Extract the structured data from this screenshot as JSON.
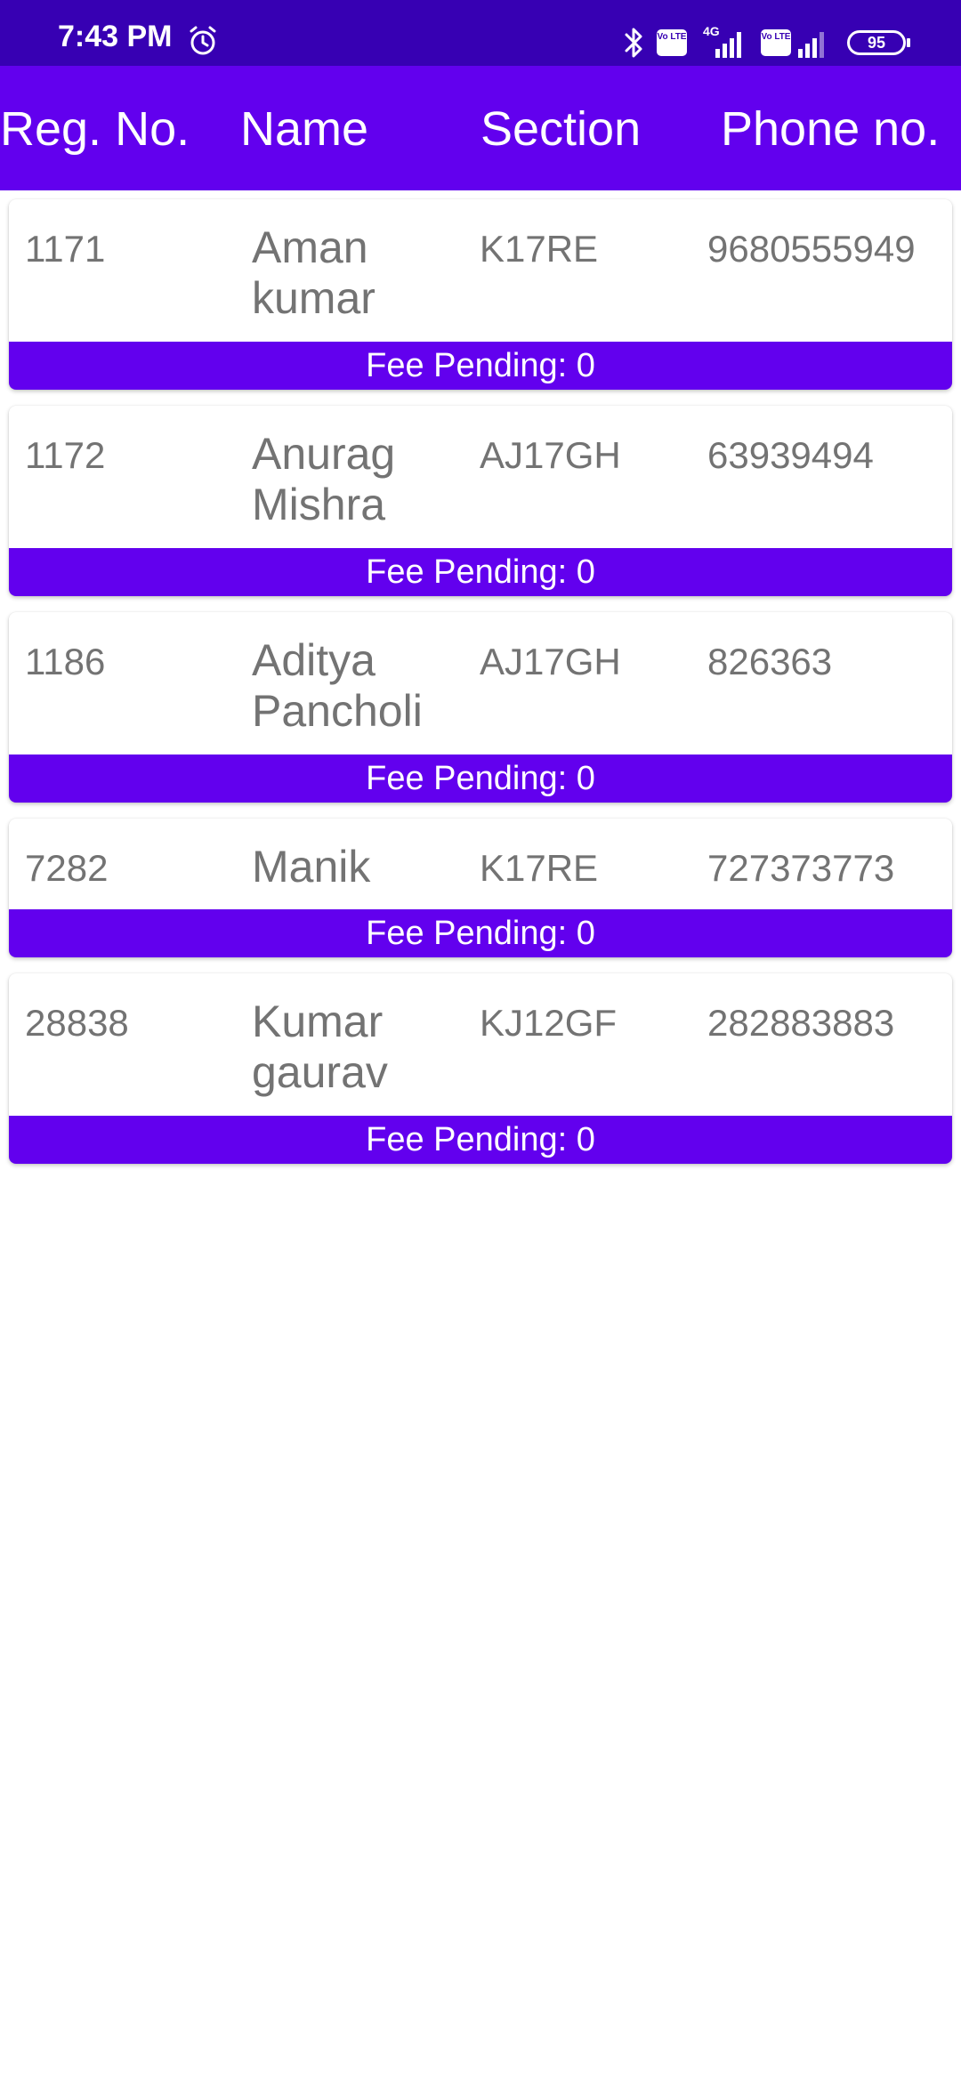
{
  "status_bar": {
    "time": "7:43 PM",
    "network_type": "4G",
    "volte_label_1": "Vo LTE",
    "volte_label_2": "Vo LTE",
    "battery": "95",
    "icons": [
      "alarm-icon",
      "bluetooth-icon",
      "volte-icon",
      "signal-icon",
      "volte-icon",
      "signal-icon",
      "battery-icon"
    ]
  },
  "header": {
    "reg_no": "Reg. No.",
    "name": "Name",
    "section": "Section",
    "phone": "Phone no."
  },
  "students": [
    {
      "reg_no": "1171",
      "name": "Aman kumar",
      "section": "K17RE",
      "phone": "9680555949",
      "fee_pending": "Fee Pending: 0"
    },
    {
      "reg_no": "1172",
      "name": "Anurag Mishra",
      "section": "AJ17GH",
      "phone": "63939494",
      "fee_pending": "Fee Pending: 0"
    },
    {
      "reg_no": "1186",
      "name": "Aditya Pancholi",
      "section": "AJ17GH",
      "phone": "826363",
      "fee_pending": "Fee Pending: 0"
    },
    {
      "reg_no": "7282",
      "name": "Manik",
      "section": "K17RE",
      "phone": "727373773",
      "fee_pending": "Fee Pending: 0"
    },
    {
      "reg_no": "28838",
      "name": "Kumar gaurav",
      "section": "KJ12GF",
      "phone": "282883883",
      "fee_pending": "Fee Pending: 0"
    }
  ],
  "colors": {
    "status_bar": "#3700b3",
    "primary": "#6200ee",
    "text_secondary": "#737373",
    "background": "#ffffff"
  }
}
